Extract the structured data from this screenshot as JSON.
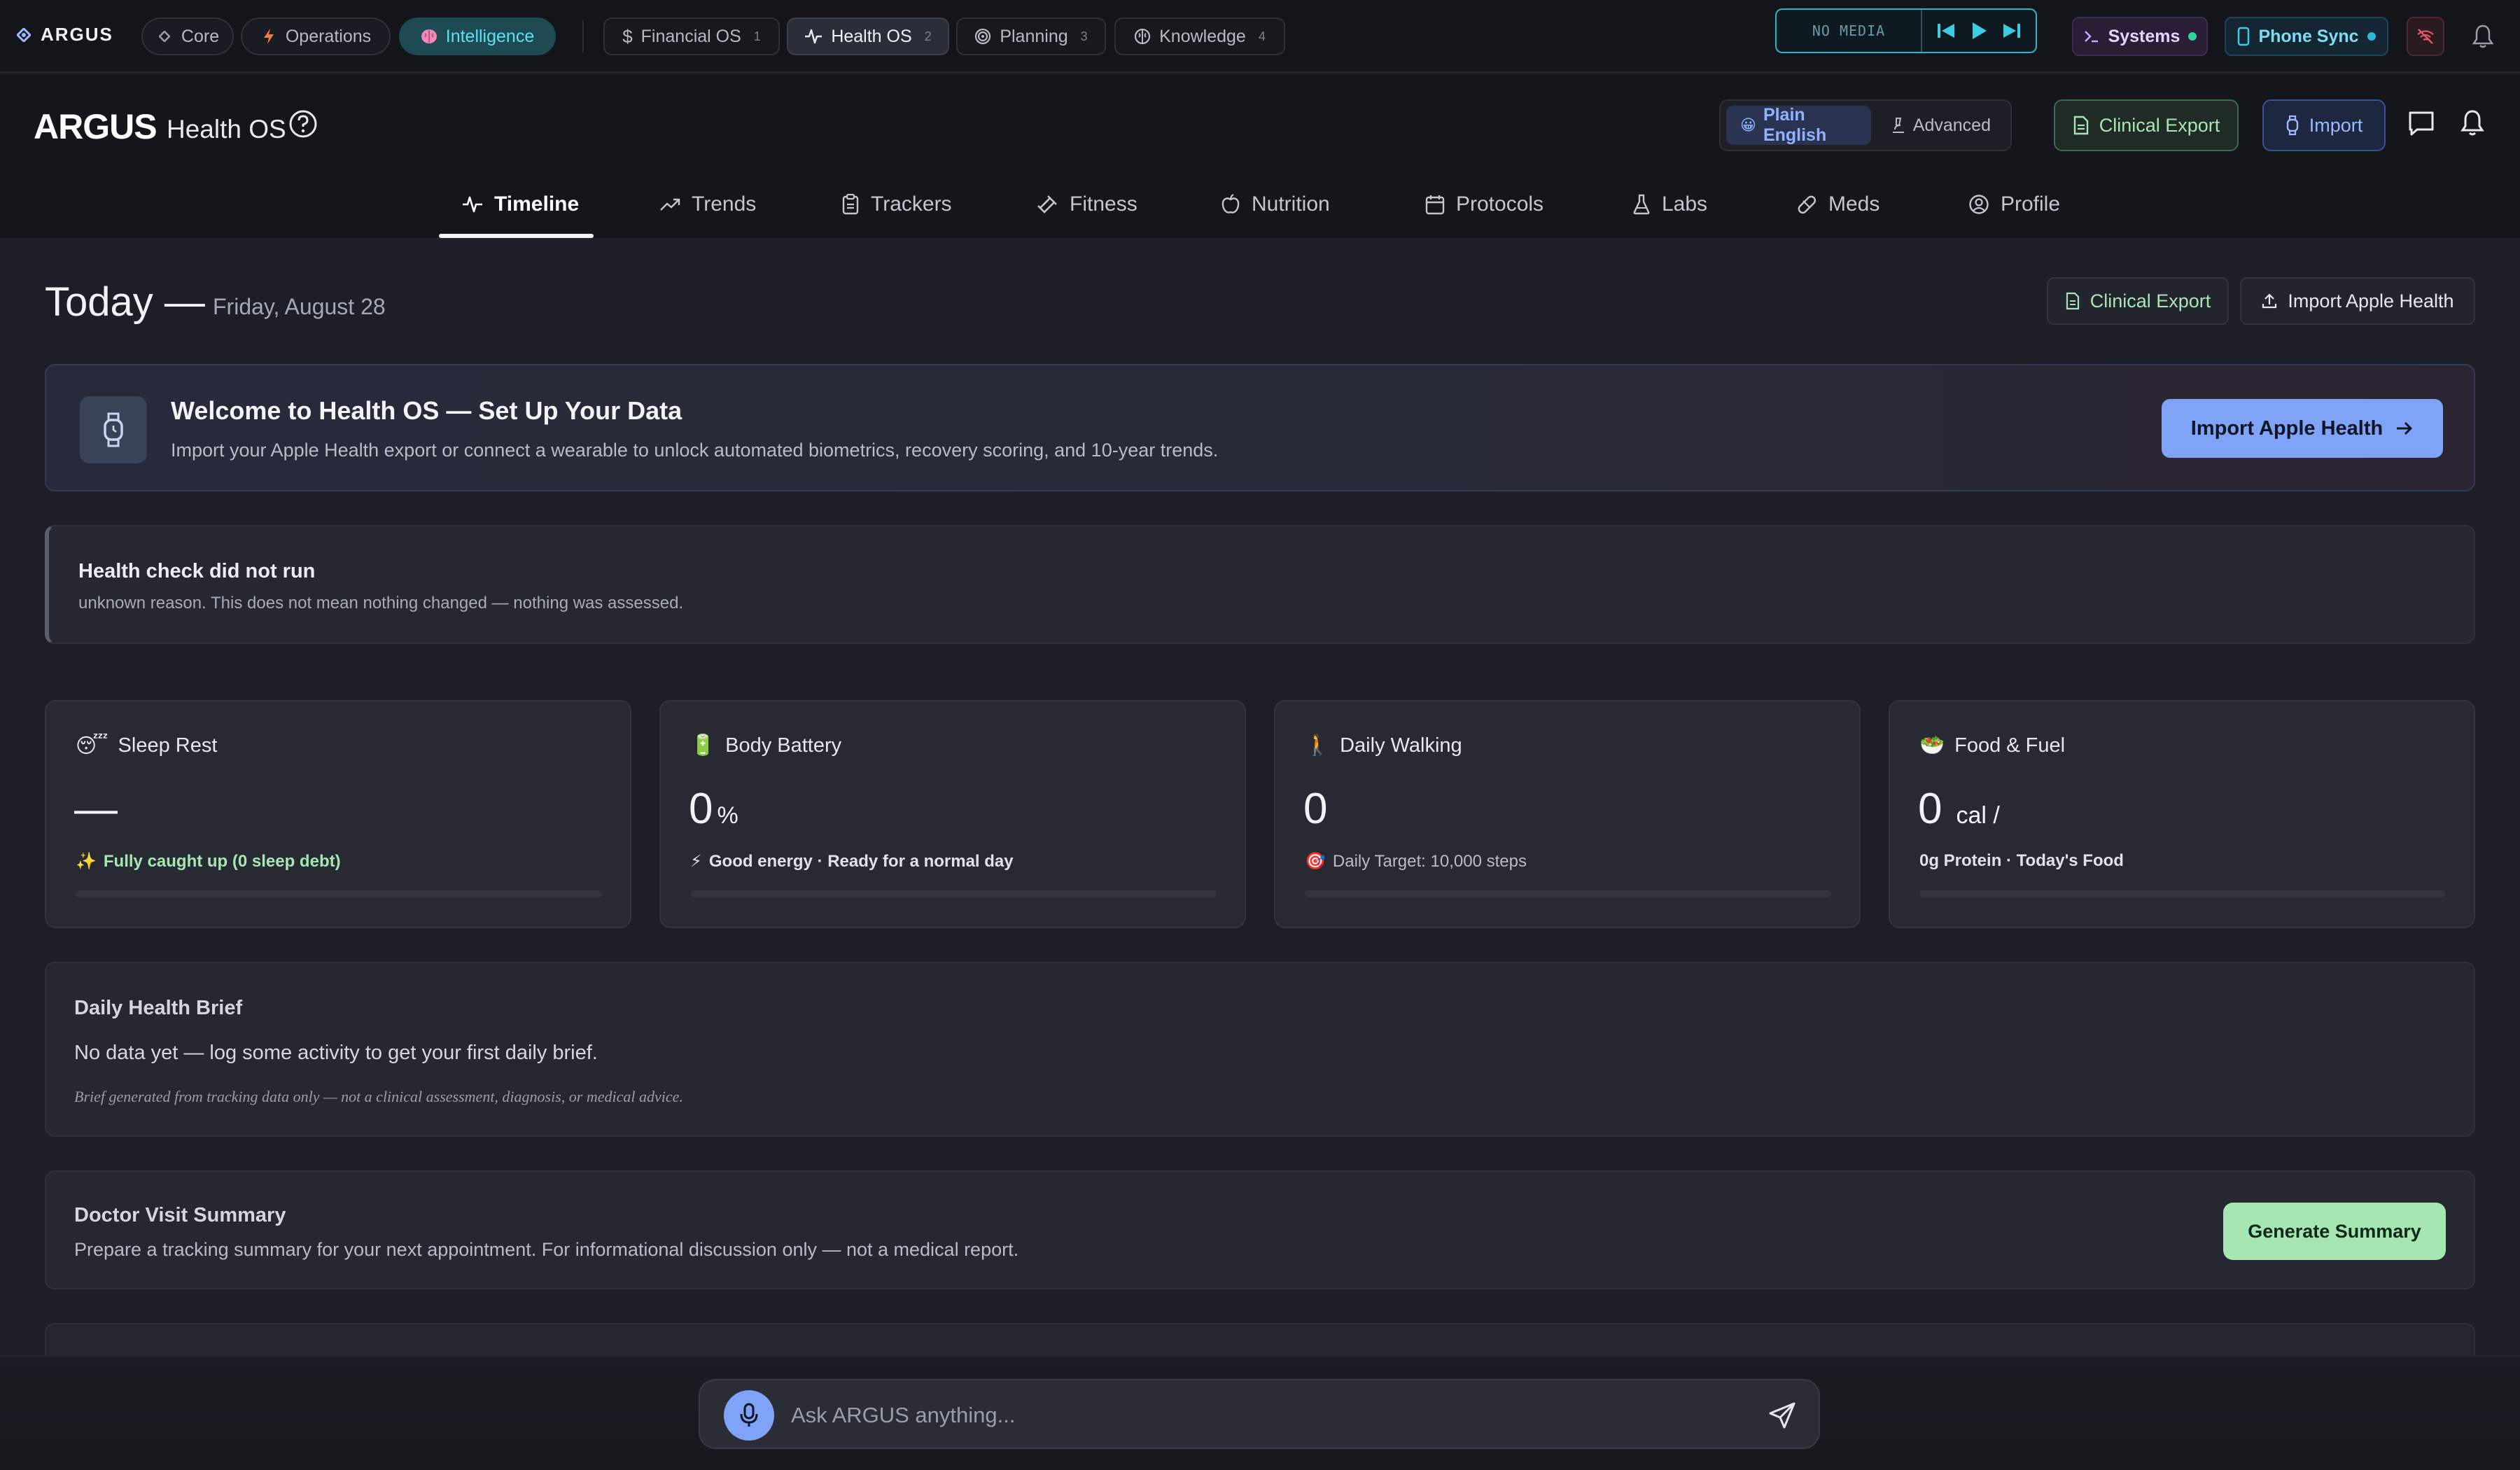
{
  "topbar": {
    "brand": "ARGUS",
    "modes": [
      {
        "label": "Core",
        "icon": "diamond-icon"
      },
      {
        "label": "Operations",
        "icon": "bolt-icon"
      },
      {
        "label": "Intelligence",
        "icon": "brain-icon",
        "active": true
      }
    ],
    "tabs": [
      {
        "label": "Financial OS",
        "num": "1",
        "icon": "dollar-icon"
      },
      {
        "label": "Health OS",
        "num": "2",
        "icon": "pulse-icon",
        "active": true
      },
      {
        "label": "Planning",
        "num": "3",
        "icon": "target-icon"
      },
      {
        "label": "Knowledge",
        "num": "4",
        "icon": "brain-outline-icon"
      }
    ],
    "media": {
      "status": "NO MEDIA"
    },
    "systems": {
      "label": "Systems",
      "status_color": "#2fd39a"
    },
    "phone_sync": {
      "label": "Phone Sync",
      "status_color": "#2fb7d3"
    }
  },
  "header": {
    "logo": "ARGUS",
    "app_name": "Health OS",
    "view_modes": [
      {
        "label": "Plain English",
        "icon": "face-emoji",
        "active": true
      },
      {
        "label": "Advanced",
        "icon": "microscope-icon"
      }
    ],
    "clinical_export": "Clinical Export",
    "import": "Import"
  },
  "nav": [
    {
      "label": "Timeline",
      "icon": "pulse-icon",
      "active": true
    },
    {
      "label": "Trends",
      "icon": "trend-up-icon"
    },
    {
      "label": "Trackers",
      "icon": "clipboard-icon"
    },
    {
      "label": "Fitness",
      "icon": "dumbbell-icon"
    },
    {
      "label": "Nutrition",
      "icon": "apple-icon"
    },
    {
      "label": "Protocols",
      "icon": "calendar-icon"
    },
    {
      "label": "Labs",
      "icon": "flask-icon"
    },
    {
      "label": "Meds",
      "icon": "pill-icon"
    },
    {
      "label": "Profile",
      "icon": "user-circle-icon"
    }
  ],
  "main": {
    "today": "Today —",
    "date": "Friday, August 28",
    "actions": {
      "clinical_export": "Clinical Export",
      "import_apple_health": "Import Apple Health"
    },
    "welcome": {
      "title": "Welcome to Health OS — Set Up Your Data",
      "subtitle": "Import your Apple Health export or connect a wearable to unlock automated biometrics, recovery scoring, and 10-year trends.",
      "button": "Import Apple Health"
    },
    "health_check": {
      "title": "Health check did not run",
      "subtitle": "unknown reason. This does not mean nothing changed — nothing was assessed."
    },
    "cards": [
      {
        "emoji": "😴",
        "title": "Sleep Rest",
        "value": "—",
        "unit": "",
        "status_emoji": "✨",
        "status": "Fully caught up (0 sleep debt)",
        "status_color": "#a6e6b2",
        "progress": 0
      },
      {
        "emoji": "🔋",
        "title": "Body Battery",
        "value": "0",
        "unit": "%",
        "status_emoji": "⚡",
        "status": "Good energy · Ready for a normal day",
        "status_color": "#e0e2e8",
        "progress": 0
      },
      {
        "emoji": "🚶",
        "title": "Daily Walking",
        "value": "0",
        "unit": "",
        "status_emoji": "🎯",
        "status": "Daily Target: 10,000 steps",
        "status_color": "#b9bcc6",
        "progress": 0
      },
      {
        "emoji": "🥗",
        "title": "Food & Fuel",
        "value": "0",
        "unit": "cal /",
        "status_emoji": "",
        "status": "0g Protein · Today's Food",
        "status_color": "#e0e2e8",
        "progress": 0
      }
    ],
    "brief": {
      "title": "Daily Health Brief",
      "body": "No data yet — log some activity to get your first daily brief.",
      "note": "Brief generated from tracking data only — not a clinical assessment, diagnosis, or medical advice."
    },
    "doctor": {
      "title": "Doctor Visit Summary",
      "subtitle": "Prepare a tracking summary for your next appointment. For informational discussion only — not a medical report.",
      "button": "Generate Summary"
    }
  },
  "chat": {
    "placeholder": "Ask ARGUS anything..."
  },
  "colors": {
    "accent": "#7ea3f7",
    "success": "#a6e6b2",
    "intelligence": "#5ee0f0",
    "background": "#1c1f27"
  }
}
